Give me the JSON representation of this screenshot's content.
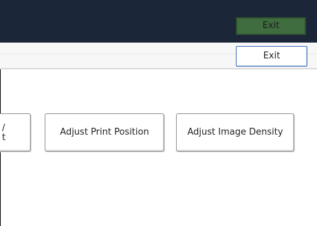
{
  "header": {
    "exit_label": "Exit"
  },
  "toolbar": {
    "exit_label": "Exit"
  },
  "buttons": {
    "partial_label_line1": "/",
    "partial_label_line2": "t",
    "adjust_print_position": "Adjust Print Position",
    "adjust_image_density": "Adjust Image Density"
  }
}
